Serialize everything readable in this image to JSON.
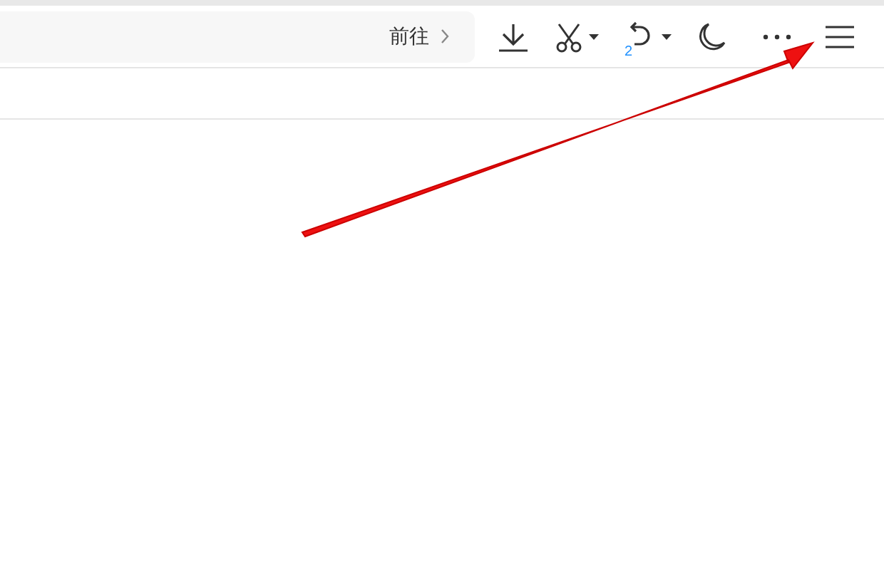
{
  "address_bar": {
    "go_button": "前往"
  },
  "toolbar": {
    "undo_count": "2"
  }
}
